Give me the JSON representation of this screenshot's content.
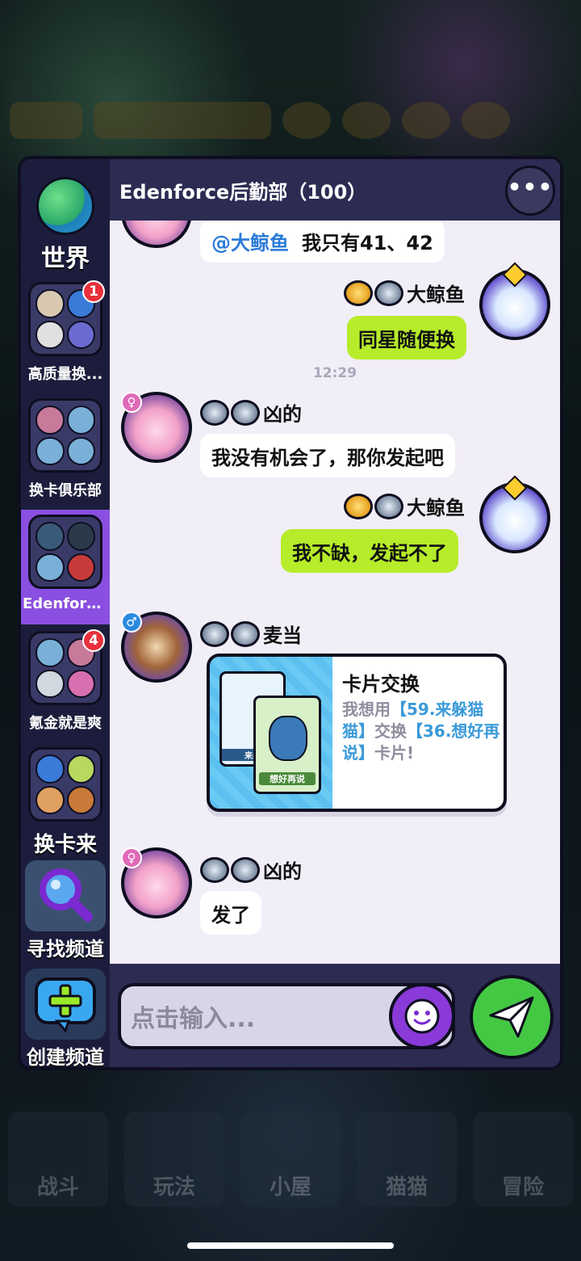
{
  "colors": {
    "panel_bg": "#1c1d3c",
    "chat_bg": "#f2eef8",
    "active_channel": "#8a4fe0",
    "my_bubble": "#b6ec2a",
    "badge_red": "#e8303a",
    "mention_blue": "#2a7ad8",
    "send_green": "#44c844"
  },
  "background": {
    "bottom_nav": [
      "战斗",
      "玩法",
      "小屋",
      "猫猫",
      "冒险"
    ]
  },
  "sidebar": {
    "world_label": "世界",
    "channels": [
      {
        "label": "高质量换...",
        "badge": "1"
      },
      {
        "label": "换卡俱乐部",
        "badge": ""
      },
      {
        "label": "Edenforc...",
        "badge": "",
        "active": true
      },
      {
        "label": "氪金就是爽",
        "badge": "4"
      },
      {
        "label": "换卡来",
        "badge": ""
      }
    ],
    "find_channel_label": "寻找频道",
    "create_channel_label": "创建频道"
  },
  "chat": {
    "title": "Edenforce后勤部（100）",
    "more_icon": "more-icon",
    "messages": [
      {
        "sender": "",
        "mention": "@大鲸鱼",
        "text": "我只有41、42"
      },
      {
        "sender": "大鲸鱼",
        "text": "同星随便换"
      },
      {
        "timestamp": "12:29"
      },
      {
        "sender": "凶的",
        "gender": "♀",
        "text": "我没有机会了，那你发起吧"
      },
      {
        "sender": "大鲸鱼",
        "text": "我不缺，发起不了"
      },
      {
        "sender": "麦当",
        "gender": "♂"
      },
      {
        "sender": "凶的",
        "gender": "♀",
        "text": "发了"
      }
    ],
    "card": {
      "title": "卡片交换",
      "prefix": "我想用",
      "offer": "【59.来躲猫猫】",
      "middle": "交换",
      "want": "【36.想好再说】",
      "suffix": "卡片!",
      "front_card_label": "想好再说",
      "back_card_label": "来躲"
    }
  },
  "input": {
    "placeholder": "点击输入..."
  }
}
